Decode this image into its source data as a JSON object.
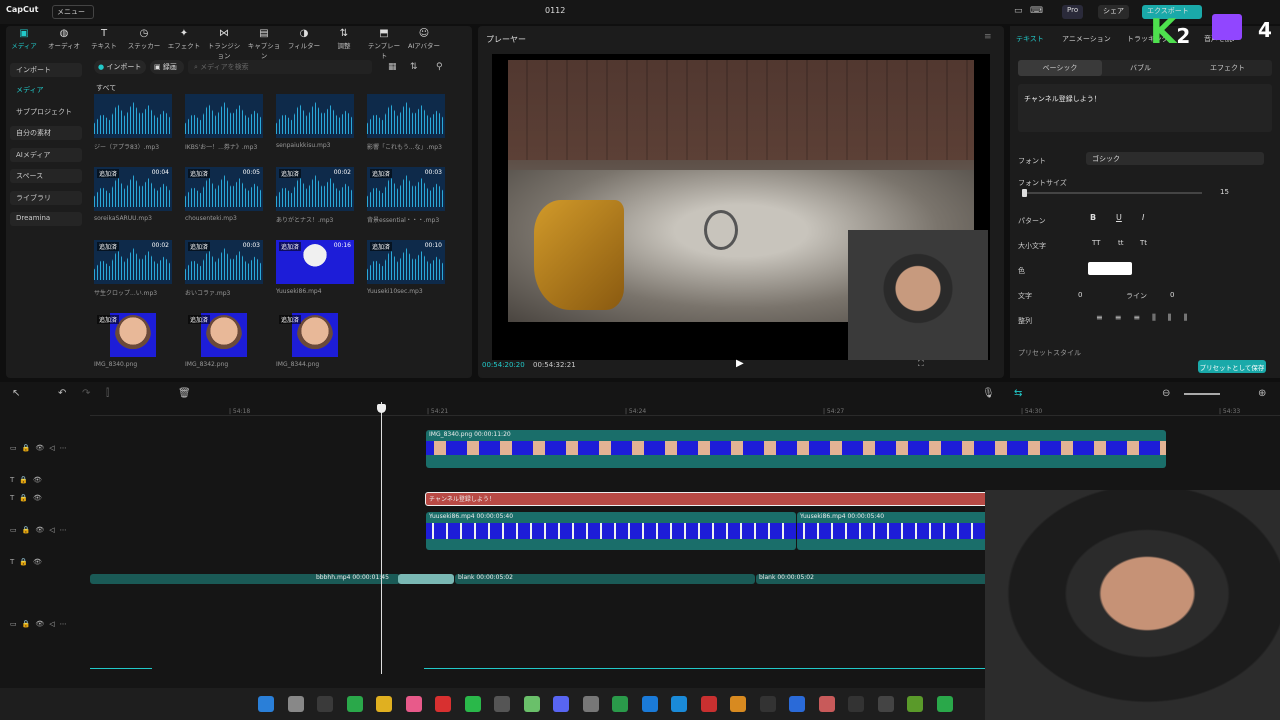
{
  "titlebar": {
    "app_name": "CapCut",
    "menu_label": "メニュー",
    "window_title": "0112",
    "pro_label": "Pro",
    "share_label": "シェア",
    "export_label": "エクスポート"
  },
  "media_toolbar": [
    {
      "label": "メディア",
      "icon": "media-icon"
    },
    {
      "label": "オーディオ",
      "icon": "audio-icon"
    },
    {
      "label": "テキスト",
      "icon": "text-icon"
    },
    {
      "label": "ステッカー",
      "icon": "sticker-icon"
    },
    {
      "label": "エフェクト",
      "icon": "effect-icon"
    },
    {
      "label": "トランジション",
      "icon": "transition-icon"
    },
    {
      "label": "キャプション",
      "icon": "caption-icon"
    },
    {
      "label": "フィルター",
      "icon": "filter-icon"
    },
    {
      "label": "調整",
      "icon": "adjust-icon"
    },
    {
      "label": "テンプレート",
      "icon": "template-icon"
    },
    {
      "label": "AIアバター",
      "icon": "ai-avatar-icon"
    }
  ],
  "sidebar": [
    {
      "label": "インポート"
    },
    {
      "label": "メディア"
    },
    {
      "label": "サブプロジェクト"
    },
    {
      "label": "自分の素材"
    },
    {
      "label": "AIメディア"
    },
    {
      "label": "スペース"
    },
    {
      "label": "ライブラリ"
    },
    {
      "label": "Dreamina"
    }
  ],
  "media_header": {
    "import_button": "インポート",
    "record_button": "録画",
    "search_placeholder": "メディアを検索",
    "section_all": "すべて"
  },
  "media_items": [
    {
      "name": "ジー（アプラ83）.mp3",
      "added": "",
      "duration": "",
      "kind": "audio"
    },
    {
      "name": "IKBS'お一！...券ナ》.mp3",
      "added": "",
      "duration": "",
      "kind": "audio"
    },
    {
      "name": "senpaiukkisu.mp3",
      "added": "",
      "duration": "",
      "kind": "audio"
    },
    {
      "name": "影響「これもう...な」.mp3",
      "added": "",
      "duration": "",
      "kind": "audio"
    },
    {
      "name": "soreikaSARUU.mp3",
      "added": "追加済",
      "duration": "00:04",
      "kind": "audio"
    },
    {
      "name": "chousenteki.mp3",
      "added": "追加済",
      "duration": "00:05",
      "kind": "audio"
    },
    {
      "name": "ありがとナス！.mp3",
      "added": "追加済",
      "duration": "00:02",
      "kind": "audio"
    },
    {
      "name": "背景essential・・・.mp3",
      "added": "追加済",
      "duration": "00:03",
      "kind": "audio"
    },
    {
      "name": "サ生クロップ...い.mp3",
      "added": "追加済",
      "duration": "00:02",
      "kind": "audio"
    },
    {
      "name": "おいコラァ.mp3",
      "added": "追加済",
      "duration": "00:03",
      "kind": "audio"
    },
    {
      "name": "Yuuseki86.mp4",
      "added": "追加済",
      "duration": "00:16",
      "kind": "video"
    },
    {
      "name": "Yuuseki10sec.mp3",
      "added": "追加済",
      "duration": "00:10",
      "kind": "audio"
    },
    {
      "name": "IMG_8340.png",
      "added": "追加済",
      "duration": "",
      "kind": "image"
    },
    {
      "name": "IMG_8342.png",
      "added": "追加済",
      "duration": "",
      "kind": "image"
    },
    {
      "name": "IMG_8344.png",
      "added": "追加済",
      "duration": "",
      "kind": "image"
    }
  ],
  "player": {
    "title": "プレーヤー",
    "current_time": "00:54:20:20",
    "total_time": "00:54:32:21"
  },
  "right_panel": {
    "tabs": [
      "テキスト",
      "アニメーション",
      "トラッキング",
      "音声を読み上げ"
    ],
    "sub_tabs": [
      "ベーシック",
      "バブル",
      "エフェクト"
    ],
    "text_value": "チャンネル登録しよう！",
    "font_label": "フォント",
    "font_value": "ゴシック",
    "font_size_label": "フォントサイズ",
    "font_size_value": "15",
    "pattern_label": "パターン",
    "case_label": "大小文字",
    "color_label": "色",
    "char_label": "文字",
    "char_value": "0",
    "line_label": "ライン",
    "line_value": "0",
    "align_label": "整列",
    "preset_style_label": "プリセットスタイル",
    "save_preset_button": "プリセットとして保存"
  },
  "timeline": {
    "ruler_ticks": [
      "| 54:18",
      "| 54:21",
      "| 54:24",
      "| 54:27",
      "| 54:30",
      "| 54:33"
    ],
    "clips": [
      {
        "label": "IMG_8340.png  00:00:11:20"
      },
      {
        "label": "チャンネル登録しよう！"
      },
      {
        "label": "Yuuseki86.mp4  00:00:05:40"
      },
      {
        "label": "Yuuseki86.mp4  00:00:05:40"
      },
      {
        "label": "blank  00:00:05:02"
      },
      {
        "label": "blank  00:00:05:02"
      },
      {
        "label": "bbbhh.mp4  00:00:01:45"
      }
    ]
  },
  "overlay": {
    "k_letter": "K",
    "k_number": "2",
    "tw_number": "4"
  },
  "colors": {
    "accent": "#22c9c9",
    "text_clip": "#b84a45",
    "video_clip": "#1a6e6a",
    "face_bg": "#1d1dd8"
  }
}
